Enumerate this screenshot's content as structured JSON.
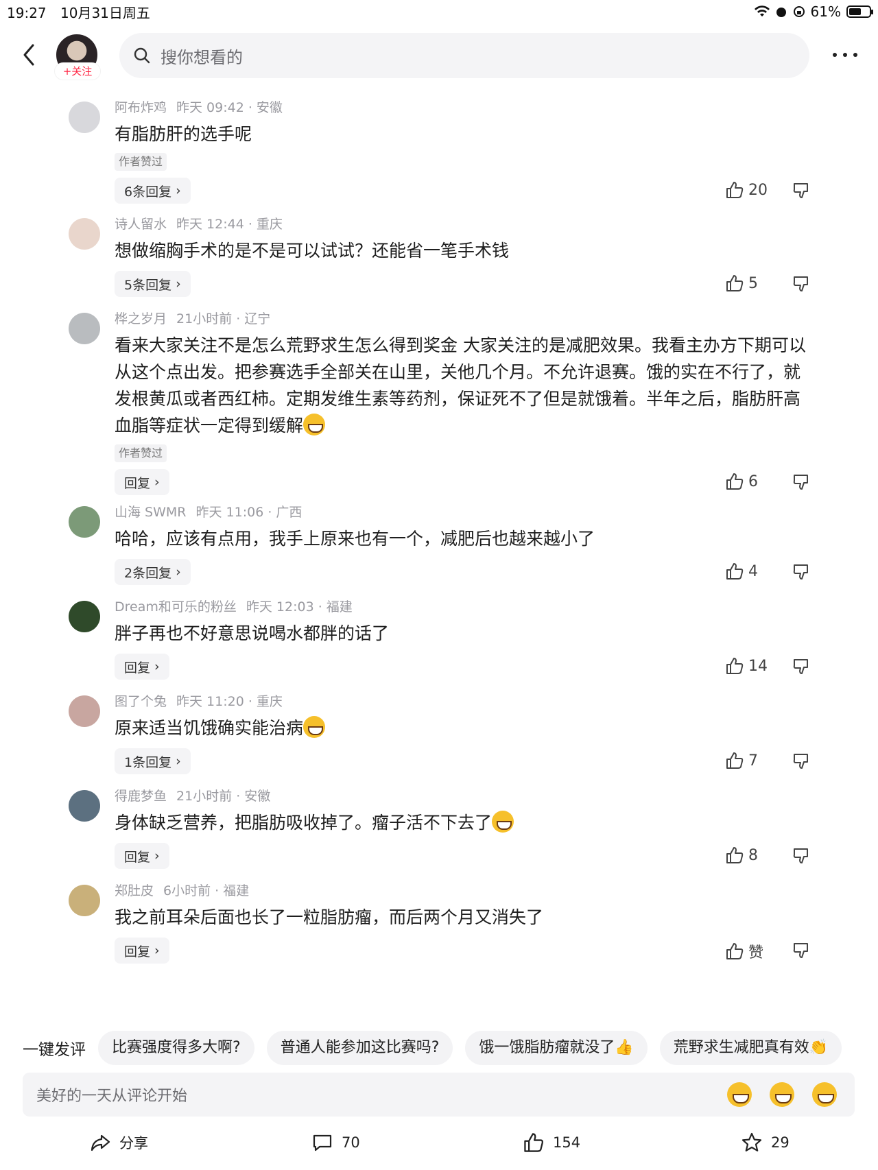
{
  "status": {
    "time": "19:27",
    "date": "10月31日周五",
    "battery": "61%"
  },
  "header": {
    "follow": "+关注",
    "search_placeholder": "搜你想看的"
  },
  "comments": [
    {
      "name": "阿布炸鸡",
      "time": "昨天 09:42 · 安徽",
      "text": "有脂肪肝的选手呢",
      "tag": "作者赞过",
      "reply": "6条回复",
      "likes": "20",
      "avatar_color": "#d8d8dc"
    },
    {
      "name": "诗人留水",
      "time": "昨天 12:44 · 重庆",
      "text": "想做缩胸手术的是不是可以试试？还能省一笔手术钱",
      "tag": "",
      "reply": "5条回复",
      "likes": "5",
      "avatar_color": "#e9d6cc"
    },
    {
      "name": "桦之岁月",
      "time": "21小时前 · 辽宁",
      "text": "看来大家关注不是怎么荒野求生怎么得到奖金 大家关注的是减肥效果。我看主办方下期可以从这个点出发。把参赛选手全部关在山里，关他几个月。不允许退赛。饿的实在不行了，就发根黄瓜或者西红柿。定期发维生素等药剂，保证死不了但是就饿着。半年之后，脂肪肝高血脂等症状一定得到缓解",
      "tag": "作者赞过",
      "reply": "回复",
      "likes": "6",
      "avatar_color": "#b9bcbf",
      "emoji": true
    },
    {
      "name": "山海 SWMR",
      "time": "昨天 11:06 · 广西",
      "text": "哈哈，应该有点用，我手上原来也有一个，减肥后也越来越小了",
      "tag": "",
      "reply": "2条回复",
      "likes": "4",
      "avatar_color": "#7c9a78"
    },
    {
      "name": "Dream和可乐的粉丝",
      "time": "昨天 12:03 · 福建",
      "text": "胖子再也不好意思说喝水都胖的话了",
      "tag": "",
      "reply": "回复",
      "likes": "14",
      "avatar_color": "#2f4a2a"
    },
    {
      "name": "图了个兔",
      "time": "昨天 11:20 · 重庆",
      "text": "原来适当饥饿确实能治病",
      "tag": "",
      "reply": "1条回复",
      "likes": "7",
      "avatar_color": "#c8a6a0",
      "emoji": true
    },
    {
      "name": "得鹿梦鱼",
      "time": "21小时前 · 安徽",
      "text": "身体缺乏营养，把脂肪吸收掉了。瘤子活不下去了",
      "tag": "",
      "reply": "回复",
      "likes": "8",
      "avatar_color": "#5c7080",
      "emoji": true
    },
    {
      "name": "郑肚皮",
      "time": "6小时前 · 福建",
      "text": "我之前耳朵后面也长了一粒脂肪瘤，而后两个月又消失了",
      "tag": "",
      "reply": "回复",
      "likes": "赞",
      "avatar_color": "#c9b07a"
    }
  ],
  "quick_comments": {
    "label": "一键发评",
    "chips": [
      "比赛强度得多大啊?",
      "普通人能参加这比赛吗?",
      "饿一饿脂肪瘤就没了👍",
      "荒野求生减肥真有效👏"
    ]
  },
  "input": {
    "placeholder": "美好的一天从评论开始"
  },
  "bottom": {
    "share": "分享",
    "comments": "70",
    "likes": "154",
    "favorites": "29"
  }
}
